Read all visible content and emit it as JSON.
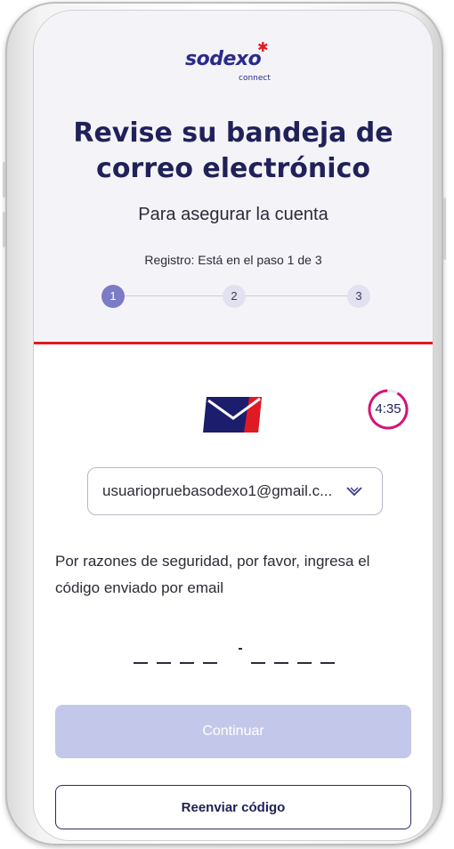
{
  "brand": {
    "logo_text": "sodexo",
    "logo_subtext": "connect",
    "accent_color": "#e01a22",
    "primary_color": "#21215a"
  },
  "header": {
    "title_line1": "Revise su bandeja de",
    "title_line2": "correo electrónico",
    "subtitle": "Para asegurar la cuenta",
    "step_text": "Registro: Está en el paso 1 de 3"
  },
  "stepper": {
    "current": 1,
    "steps": [
      "1",
      "2",
      "3"
    ]
  },
  "timer": {
    "text": "4:35"
  },
  "email_select": {
    "value": "usuariopruebasodexo1@gmail.c..."
  },
  "info_text": "Por razones de seguridad, por favor, ingresa el código enviado por email",
  "code_input": {
    "left_slots": 4,
    "right_slots": 4
  },
  "buttons": {
    "continue_label": "Continuar",
    "resend_label": "Reenviar código"
  }
}
